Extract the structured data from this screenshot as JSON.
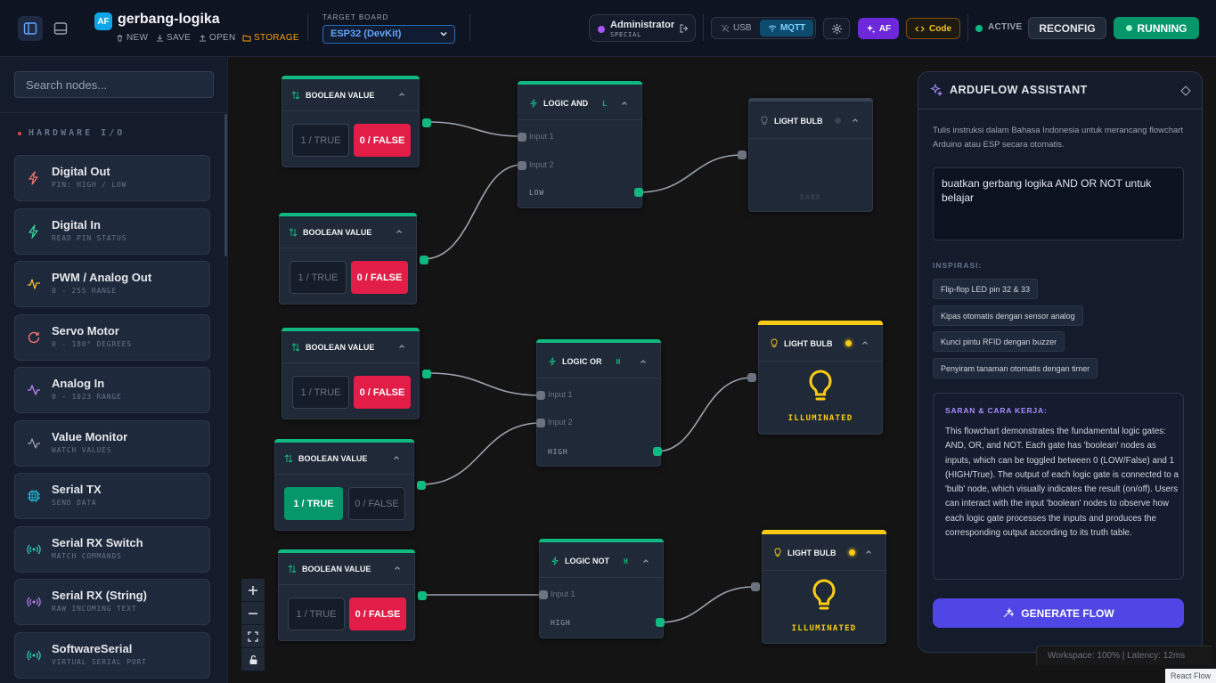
{
  "header": {
    "logo_text": "AF",
    "project_name": "gerbang-logika",
    "actions": {
      "new": "NEW",
      "save": "SAVE",
      "open": "OPEN",
      "storage": "STORAGE"
    },
    "board_label": "TARGET BOARD",
    "board_value": "ESP32 (DevKit)",
    "user_name": "Administrator",
    "user_role": "SPECIAL",
    "conn_usb": "USB",
    "conn_mqtt": "MQTT",
    "af_label": "AF",
    "code_label": "Code",
    "status_label": "ACTIVE",
    "reconfig_label": "RECONFIG",
    "running_label": "RUNNING"
  },
  "sidebar": {
    "search_placeholder": "Search nodes...",
    "section_title": "HARDWARE I/O",
    "items": [
      {
        "name": "Digital Out",
        "sub": "PIN: HIGH / LOW",
        "icon": "zap-icon",
        "color": "#f87171"
      },
      {
        "name": "Digital In",
        "sub": "READ PIN STATUS",
        "icon": "zap-icon",
        "color": "#34d399"
      },
      {
        "name": "PWM / Analog Out",
        "sub": "0 - 255 RANGE",
        "icon": "pulse-icon",
        "color": "#fbbf24"
      },
      {
        "name": "Servo Motor",
        "sub": "0 - 180° DEGREES",
        "icon": "rotate-icon",
        "color": "#f87171"
      },
      {
        "name": "Analog In",
        "sub": "0 - 1023 RANGE",
        "icon": "activity-icon",
        "color": "#c084fc"
      },
      {
        "name": "Value Monitor",
        "sub": "WATCH VALUES",
        "icon": "activity-icon",
        "color": "#9ca3af"
      },
      {
        "name": "Serial TX",
        "sub": "SEND DATA",
        "icon": "chip-icon",
        "color": "#22d3ee"
      },
      {
        "name": "Serial RX Switch",
        "sub": "MATCH COMMANDS",
        "icon": "radio-icon",
        "color": "#2dd4bf"
      },
      {
        "name": "Serial RX (String)",
        "sub": "RAW INCOMING TEXT",
        "icon": "radio-icon",
        "color": "#c084fc"
      },
      {
        "name": "SoftwareSerial",
        "sub": "VIRTUAL SERIAL PORT",
        "icon": "radio-icon",
        "color": "#2dd4bf"
      }
    ]
  },
  "canvas": {
    "bool_nodes": [
      {
        "title": "BOOLEAN VALUE",
        "true_label": "1 / TRUE",
        "false_label": "0 / FALSE",
        "value": false
      },
      {
        "title": "BOOLEAN VALUE",
        "true_label": "1 / TRUE",
        "false_label": "0 / FALSE",
        "value": false
      },
      {
        "title": "BOOLEAN VALUE",
        "true_label": "1 / TRUE",
        "false_label": "0 / FALSE",
        "value": false
      },
      {
        "title": "BOOLEAN VALUE",
        "true_label": "1 / TRUE",
        "false_label": "0 / FALSE",
        "value": true
      },
      {
        "title": "BOOLEAN VALUE",
        "true_label": "1 / TRUE",
        "false_label": "0 / FALSE",
        "value": false
      }
    ],
    "logic_nodes": [
      {
        "title": "LOGIC AND",
        "mode": "L",
        "input1": "Input 1",
        "input2": "Input 2",
        "output": "LOW"
      },
      {
        "title": "LOGIC OR",
        "mode": "H",
        "input1": "Input 1",
        "input2": "Input 2",
        "output": "HIGH"
      },
      {
        "title": "LOGIC NOT",
        "mode": "H",
        "input1": "Input 1",
        "output": "HIGH"
      }
    ],
    "bulb_nodes": [
      {
        "title": "LIGHT BULB",
        "state": "DARK",
        "on": false
      },
      {
        "title": "LIGHT BULB",
        "state": "ILLUMINATED",
        "on": true
      },
      {
        "title": "LIGHT BULB",
        "state": "ILLUMINATED",
        "on": true
      }
    ]
  },
  "assistant": {
    "title": "ARDUFLOW ASSISTANT",
    "intro": "Tulis instruksi dalam Bahasa Indonesia untuk merancang flowchart Arduino atau ESP secara otomatis.",
    "prompt": "buatkan gerbang logika AND OR NOT untuk belajar",
    "inspiration_label": "INSPIRASI:",
    "inspirations": [
      "Flip-flop LED pin 32 & 33",
      "Kipas otomatis dengan sensor analog",
      "Kunci pintu RFID dengan buzzer",
      "Penyiram tanaman otomatis dengan timer"
    ],
    "tips_title": "SARAN & CARA KERJA:",
    "tips_body": "This flowchart demonstrates the fundamental logic gates: AND, OR, and NOT. Each gate has 'boolean' nodes as inputs, which can be toggled between 0 (LOW/False) and 1 (HIGH/True). The output of each logic gate is connected to a 'bulb' node, which visually indicates the result (on/off). Users can interact with the input 'boolean' nodes to observe how each logic gate processes the inputs and produces the corresponding output according to its truth table.",
    "generate_label": "GENERATE FLOW"
  },
  "status": {
    "workspace": "Workspace: 100% | Latency: 12ms",
    "attribution": "React Flow"
  },
  "colors": {
    "accent_green": "#10b981",
    "accent_red": "#e11d48",
    "accent_yellow": "#facc15",
    "accent_purple": "#6d28d9"
  }
}
